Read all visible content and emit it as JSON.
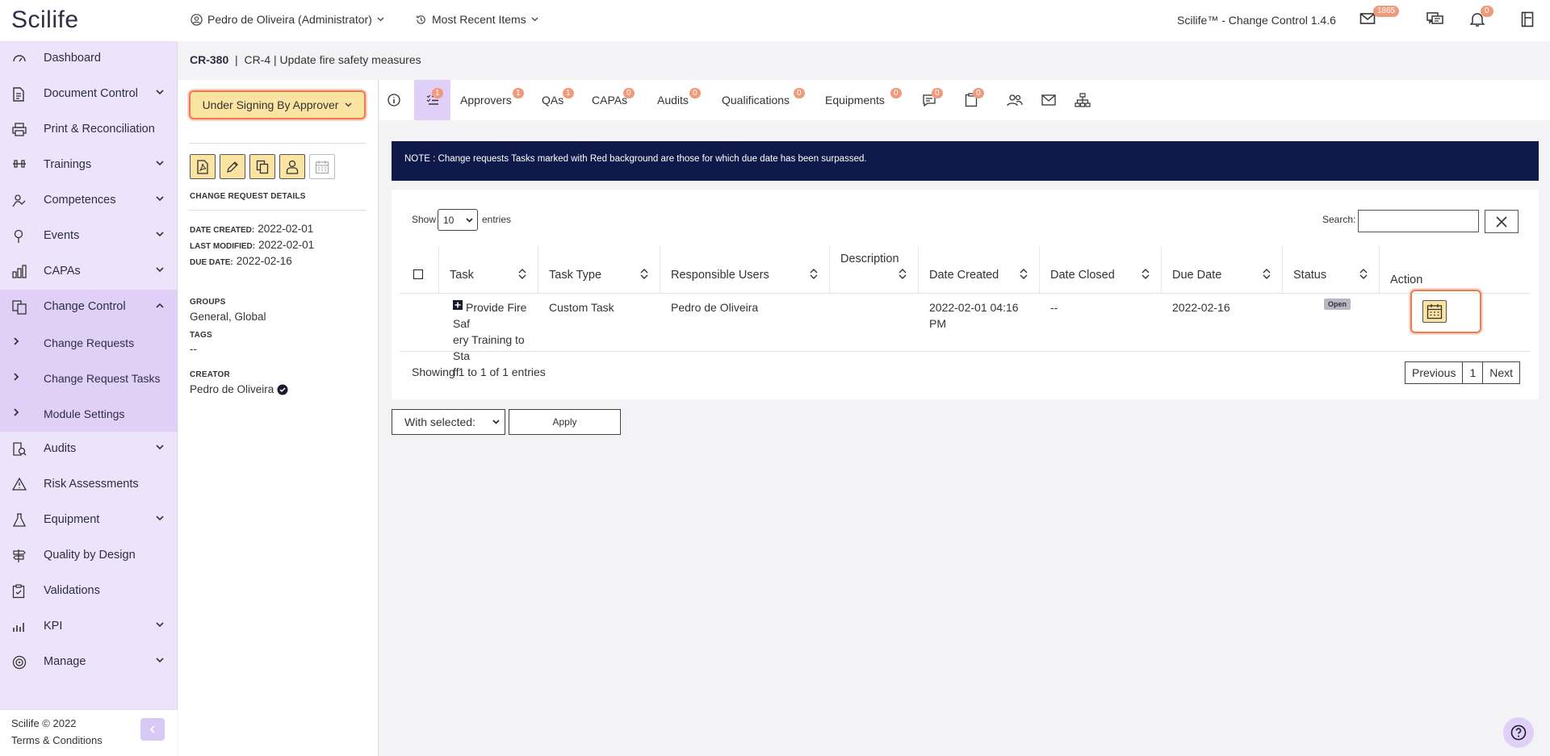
{
  "header": {
    "logo": "Scilife",
    "user": "Pedro de Oliveira (Administrator)",
    "recent": "Most Recent Items",
    "app_version": "Scilife™ - Change Control 1.4.6",
    "mail_count": "1865",
    "notif_count": "0"
  },
  "sidebar": {
    "items": [
      {
        "label": "Dashboard",
        "icon": "gauge-icon"
      },
      {
        "label": "Document Control",
        "icon": "document-icon"
      },
      {
        "label": "Print & Reconciliation",
        "icon": "printer-icon"
      },
      {
        "label": "Trainings",
        "icon": "dumbbell-icon"
      },
      {
        "label": "Competences",
        "icon": "competence-icon"
      },
      {
        "label": "Events",
        "icon": "pin-icon"
      },
      {
        "label": "CAPAs",
        "icon": "chart-icon"
      },
      {
        "label": "Change Control",
        "icon": "change-icon"
      },
      {
        "label": "Audits",
        "icon": "audit-icon"
      },
      {
        "label": "Risk Assessments",
        "icon": "warning-icon"
      },
      {
        "label": "Equipment",
        "icon": "flask-icon"
      },
      {
        "label": "Quality by Design",
        "icon": "signpost-icon"
      },
      {
        "label": "Validations",
        "icon": "clipboard-icon"
      },
      {
        "label": "KPI",
        "icon": "bars-icon"
      },
      {
        "label": "Manage",
        "icon": "target-icon"
      }
    ],
    "sub_items": [
      "Change Requests",
      "Change Request Tasks",
      "Module Settings"
    ],
    "footer_copy": "Scilife © 2022",
    "footer_terms": "Terms & Conditions"
  },
  "breadcrumb": {
    "id": "CR-380",
    "sep": "|",
    "title": "CR-4 | Update fire safety measures"
  },
  "detail": {
    "status": "Under Signing By Approver",
    "section_title": "CHANGE REQUEST DETAILS",
    "date_created_label": "DATE CREATED:",
    "date_created": "2022-02-01",
    "last_modified_label": "LAST MODIFIED:",
    "last_modified": "2022-02-01",
    "due_date_label": "DUE DATE:",
    "due_date": "2022-02-16",
    "groups_label": "GROUPS",
    "groups": "General, Global",
    "tags_label": "TAGS",
    "tags": "--",
    "creator_label": "CREATOR",
    "creator": "Pedro de Oliveira"
  },
  "tabs": {
    "tasks_badge": "1",
    "approvers": "Approvers",
    "approvers_badge": "1",
    "qas": "QAs",
    "qas_badge": "1",
    "capas": "CAPAs",
    "capas_badge": "0",
    "audits": "Audits",
    "audits_badge": "0",
    "qualifications": "Qualifications",
    "qualifications_badge": "0",
    "equipments": "Equipments",
    "equipments_badge": "0",
    "comments_badge": "0",
    "docs_badge": "0"
  },
  "note": "NOTE : Change requests Tasks marked with Red background are those for which due date has been surpassed.",
  "table": {
    "show": "Show",
    "entries_value": "10",
    "entries": "entries",
    "search_label": "Search:",
    "columns": [
      "Task",
      "Task Type",
      "Responsible Users",
      "Description",
      "Date Created",
      "Date Closed",
      "Due Date",
      "Status",
      "Action"
    ],
    "row": {
      "task_l1": "Provide Fire Saf",
      "task_l2": "ery Training to Sta",
      "task_l3": "ff",
      "type": "Custom Task",
      "responsible": "Pedro de Oliveira",
      "date_created_l1": "2022-02-01 04:16",
      "date_created_l2": "PM",
      "date_closed": "--",
      "due_date": "2022-02-16",
      "status": "Open"
    },
    "showing": "Showing 1 to 1 of 1 entries",
    "prev": "Previous",
    "page": "1",
    "next": "Next"
  },
  "bulk": {
    "with_selected": "With selected:",
    "apply": "Apply"
  }
}
